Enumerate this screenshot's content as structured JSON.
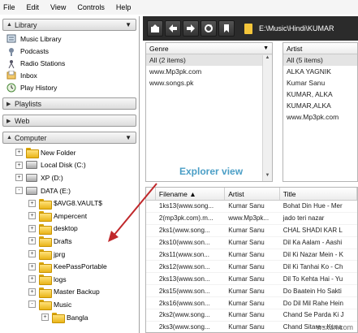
{
  "menu": [
    "File",
    "Edit",
    "View",
    "Controls",
    "Help"
  ],
  "library": {
    "header": "Library",
    "items": [
      {
        "label": "Music Library",
        "icon": "music-library-icon"
      },
      {
        "label": "Podcasts",
        "icon": "podcast-icon"
      },
      {
        "label": "Radio Stations",
        "icon": "radio-icon"
      },
      {
        "label": "Inbox",
        "icon": "inbox-icon"
      },
      {
        "label": "Play History",
        "icon": "history-icon"
      }
    ]
  },
  "playlists_header": "Playlists",
  "web_header": "Web",
  "computer": {
    "header": "Computer",
    "tree": [
      {
        "label": "New Folder",
        "type": "folder",
        "level": 1,
        "exp": "+"
      },
      {
        "label": "Local Disk (C:)",
        "type": "drive",
        "level": 1,
        "exp": "+"
      },
      {
        "label": "XP (D:)",
        "type": "drive",
        "level": 1,
        "exp": "+"
      },
      {
        "label": "DATA (E:)",
        "type": "drive",
        "level": 1,
        "exp": "-"
      },
      {
        "label": "$AVG8.VAULT$",
        "type": "folder",
        "level": 2,
        "exp": "+"
      },
      {
        "label": "Ampercent",
        "type": "folder",
        "level": 2,
        "exp": "+"
      },
      {
        "label": "desktop",
        "type": "folder",
        "level": 2,
        "exp": "+"
      },
      {
        "label": "Drafts",
        "type": "folder",
        "level": 2,
        "exp": "+"
      },
      {
        "label": "jprg",
        "type": "folder",
        "level": 2,
        "exp": "+"
      },
      {
        "label": "KeePassPortable",
        "type": "folder",
        "level": 2,
        "exp": "+"
      },
      {
        "label": "logs",
        "type": "folder",
        "level": 2,
        "exp": "+"
      },
      {
        "label": "Master Backup",
        "type": "folder",
        "level": 2,
        "exp": "+"
      },
      {
        "label": "Music",
        "type": "folder",
        "level": 2,
        "exp": "-"
      },
      {
        "label": "Bangla",
        "type": "folder",
        "level": 3,
        "exp": "+"
      }
    ]
  },
  "toolbar": {
    "path": "E:\\Music\\Hindi\\KUMAR"
  },
  "genre": {
    "header": "Genre",
    "rows": [
      "All  (2 items)",
      "www.Mp3pk.com",
      "www.songs.pk"
    ]
  },
  "artist": {
    "header": "Artist",
    "rows": [
      "All  (5 items)",
      "ALKA YAGNIK",
      "Kumar Sanu",
      "KUMAR, ALKA",
      "KUMAR,ALKA",
      "www.Mp3pk.com"
    ]
  },
  "annotation": "Explorer view",
  "tracks": {
    "columns": [
      "Filename ▲",
      "Artist",
      "Title"
    ],
    "rows": [
      [
        "1ks13(www.song...",
        "Kumar Sanu",
        "Bohat Din Hue - Mer"
      ],
      [
        "2(mp3pk.com).m...",
        "www.Mp3pk...",
        "jado teri nazar"
      ],
      [
        "2ks1(www.song...",
        "Kumar Sanu",
        "CHAL SHADI KAR L"
      ],
      [
        "2ks10(www.son...",
        "Kumar Sanu",
        "Dil Ka Aalam - Aashi"
      ],
      [
        "2ks11(www.son...",
        "Kumar Sanu",
        "Dil Ki Nazar Mein - K"
      ],
      [
        "2ks12(www.son...",
        "Kumar Sanu",
        "Dil Ki Tanhai Ko - Ch"
      ],
      [
        "2ks13(www.son...",
        "Kumar Sanu",
        "Dil To Kehta Hai - Yu"
      ],
      [
        "2ks15(www.son...",
        "Kumar Sanu",
        "Do Baatein Ho Sakti"
      ],
      [
        "2ks16(www.son...",
        "Kumar Sanu",
        "Do Dil Mil Rahe Hein"
      ],
      [
        "2ks2(www.song...",
        "Kumar Sanu",
        "Chand Se Parda Ki J"
      ],
      [
        "2ks3(www.song...",
        "Kumar Sanu",
        "Chand Sitare - Kuna"
      ]
    ]
  },
  "watermark": "wsxdn.com",
  "colors": {
    "annotation": "#4a9ec6",
    "arrow": "#c0282b",
    "toolbar": "#2b2b2b"
  }
}
